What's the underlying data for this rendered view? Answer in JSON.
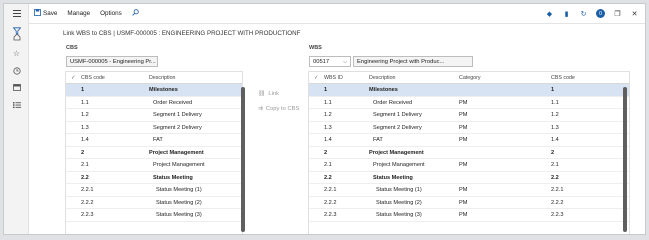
{
  "toolbar": {
    "save_label": "Save",
    "manage_label": "Manage",
    "options_label": "Options"
  },
  "page_title": "Link WBS to CBS  |  USMF-000005 : ENGINEERING PROJECT WITH PRODUCTIONF",
  "cbs": {
    "label": "CBS",
    "field_value": "USMF-000005 - Engineering Pr...",
    "columns": {
      "code": "CBS code",
      "description": "Description"
    },
    "rows": [
      {
        "code": "1",
        "description": "Milestones",
        "bold": true,
        "selected": true
      },
      {
        "code": "1.1",
        "description": "Order Received"
      },
      {
        "code": "1.2",
        "description": "Segment 1 Delivery"
      },
      {
        "code": "1.3",
        "description": "Segment 2 Delivery"
      },
      {
        "code": "1.4",
        "description": "FAT"
      },
      {
        "code": "2",
        "description": "Project Management",
        "bold": true
      },
      {
        "code": "2.1",
        "description": "Project Management"
      },
      {
        "code": "2.2",
        "description": "Status Meeting",
        "bold": true
      },
      {
        "code": "2.2.1",
        "description": "Status Meeting (1)"
      },
      {
        "code": "2.2.2",
        "description": "Status Meeting (2)"
      },
      {
        "code": "2.2.3",
        "description": "Status Meeting (3)"
      }
    ]
  },
  "actions": {
    "link_label": "Link",
    "copy_label": "Copy to CBS"
  },
  "wbs": {
    "label": "WBS",
    "select_value": "00517",
    "description_value": "Engineering Project with Produc...",
    "columns": {
      "id": "WBS ID",
      "description": "Description",
      "category": "Category",
      "cbs_code": "CBS code"
    },
    "rows": [
      {
        "id": "1",
        "description": "Milestones",
        "category": "",
        "cbs": "1",
        "bold": true,
        "selected": true
      },
      {
        "id": "1.1",
        "description": "Order Received",
        "category": "PM",
        "cbs": "1.1"
      },
      {
        "id": "1.2",
        "description": "Segment 1 Delivery",
        "category": "PM",
        "cbs": "1.2"
      },
      {
        "id": "1.3",
        "description": "Segment 2 Delivery",
        "category": "PM",
        "cbs": "1.3"
      },
      {
        "id": "1.4",
        "description": "FAT",
        "category": "PM",
        "cbs": "1.4"
      },
      {
        "id": "2",
        "description": "Project Management",
        "category": "",
        "cbs": "2",
        "bold": true
      },
      {
        "id": "2.1",
        "description": "Project Management",
        "category": "PM",
        "cbs": "2.1"
      },
      {
        "id": "2.2",
        "description": "Status Meeting",
        "category": "",
        "cbs": "2.2",
        "bold": true
      },
      {
        "id": "2.2.1",
        "description": "Status Meeting (1)",
        "category": "PM",
        "cbs": "2.2.1"
      },
      {
        "id": "2.2.2",
        "description": "Status Meeting (2)",
        "category": "PM",
        "cbs": "2.2.2"
      },
      {
        "id": "2.2.3",
        "description": "Status Meeting (3)",
        "category": "PM",
        "cbs": "2.2.3"
      }
    ]
  },
  "icons": {
    "nav": [
      "hamburger-icon",
      "home-icon",
      "star-icon",
      "clock-icon",
      "workspace-icon",
      "list-icon"
    ],
    "toolbar_right": [
      "diamond-icon",
      "office-icon",
      "refresh-icon",
      "notification-icon",
      "restore-icon",
      "close-icon"
    ],
    "notification_count": "0"
  },
  "colors": {
    "accent": "#1b5fa8",
    "selected_row": "#d7e3f2"
  }
}
